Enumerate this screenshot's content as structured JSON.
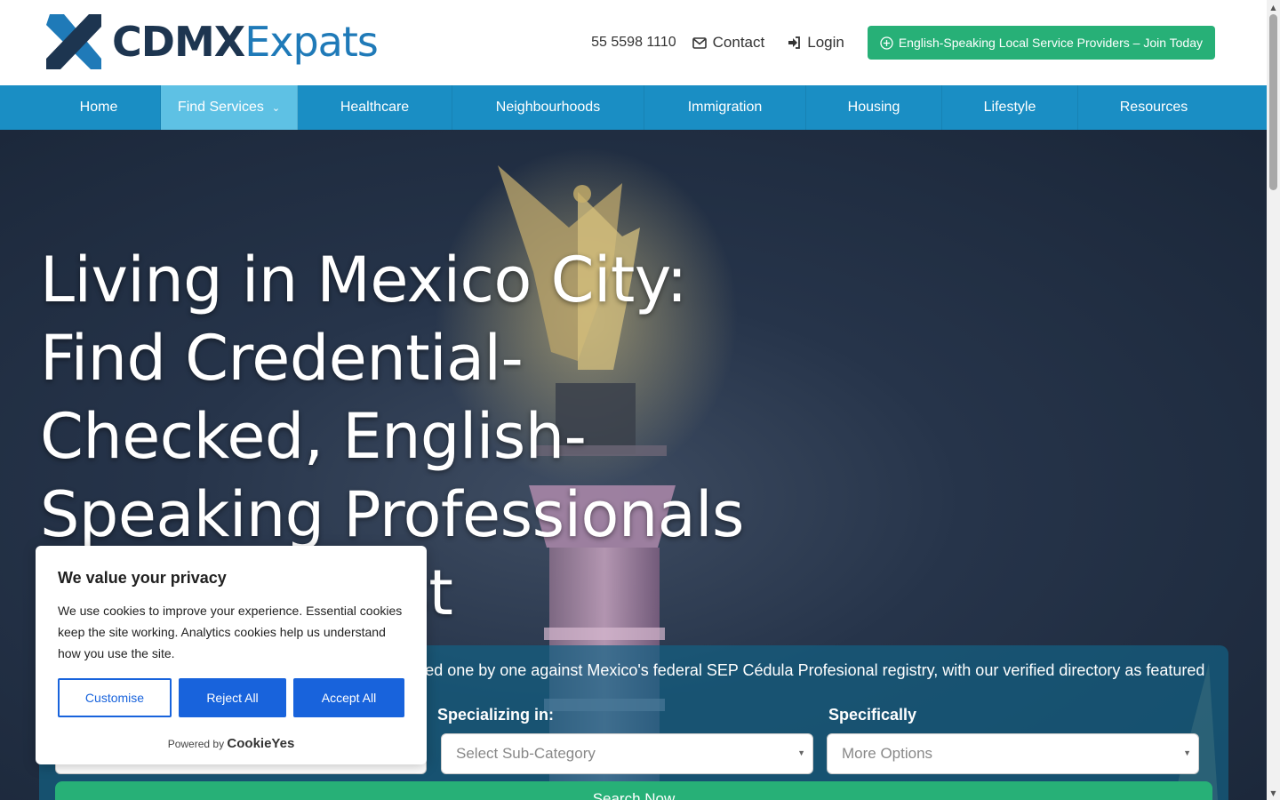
{
  "brand": {
    "name_part1": "CDMX",
    "name_part2": "Expats",
    "dark_color": "#1d3550",
    "blue_color": "#1f7ab8"
  },
  "header": {
    "phone": "55 5598 1110",
    "contact_label": "Contact",
    "login_label": "Login",
    "join_label": "English-Speaking Local Service Providers – Join Today",
    "join_color": "#27b077"
  },
  "nav": {
    "color": "#1a8ec4",
    "active_color": "#5ec1e4",
    "items": [
      {
        "label": "Home"
      },
      {
        "label": "Find Services"
      },
      {
        "label": "Healthcare"
      },
      {
        "label": "Neighbourhoods"
      },
      {
        "label": "Immigration"
      },
      {
        "label": "Housing"
      },
      {
        "label": "Lifestyle"
      },
      {
        "label": "Resources"
      }
    ]
  },
  "hero": {
    "heading": "Living in Mexico City: Find Credential-Checked, English-Speaking Professionals You Can Trust",
    "description": "English-speaking service providers credential-checked one by one against Mexico's federal SEP Cédula Profesional registry, with our verified directory as featured in Mexico News Daily.",
    "specializing_label": "Specializing in:",
    "specifically_label": "Specifically",
    "subcategory_placeholder": "Select Sub-Category",
    "more_options_placeholder": "More Options",
    "search_label": "Search Now"
  },
  "cookie": {
    "title": "We value your privacy",
    "body": "We use cookies to improve your experience. Essential cookies keep the site working. Analytics cookies help us understand how you use the site.",
    "customise_label": "Customise",
    "reject_label": "Reject All",
    "accept_label": "Accept All",
    "powered_by": "Powered by",
    "powered_brand": "CookieYes",
    "accent": "#1863dc"
  }
}
